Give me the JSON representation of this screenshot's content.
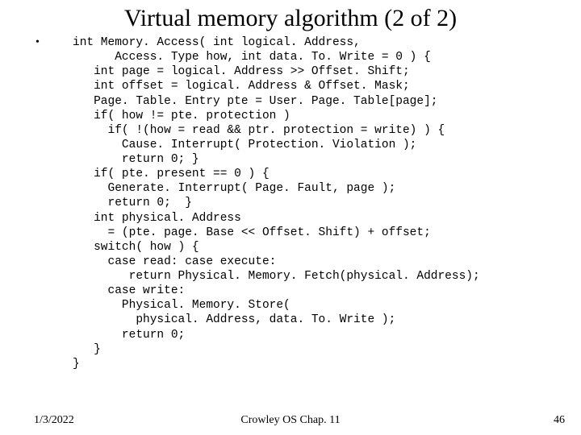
{
  "title": "Virtual memory algorithm (2 of 2)",
  "code": "int Memory. Access( int logical. Address,\n      Access. Type how, int data. To. Write = 0 ) {\n   int page = logical. Address >> Offset. Shift;\n   int offset = logical. Address & Offset. Mask;\n   Page. Table. Entry pte = User. Page. Table[page];\n   if( how != pte. protection )\n     if( !(how = read && ptr. protection = write) ) {\n       Cause. Interrupt( Protection. Violation );\n       return 0; }\n   if( pte. present == 0 ) {\n     Generate. Interrupt( Page. Fault, page );\n     return 0;  }\n   int physical. Address\n     = (pte. page. Base << Offset. Shift) + offset;\n   switch( how ) {\n     case read: case execute:\n        return Physical. Memory. Fetch(physical. Address);\n     case write:\n       Physical. Memory. Store(\n         physical. Address, data. To. Write );\n       return 0;\n   }\n}",
  "footer": {
    "date": "1/3/2022",
    "center": "Crowley    OS     Chap. 11",
    "pagenum": "46"
  }
}
